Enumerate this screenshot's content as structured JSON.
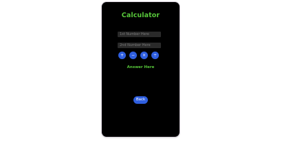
{
  "app": {
    "title": "Calculator"
  },
  "inputs": {
    "first": {
      "value": "",
      "placeholder": "1st Number Here"
    },
    "second": {
      "value": "",
      "placeholder": "2nd Number Here"
    }
  },
  "operators": [
    {
      "label": "+"
    },
    {
      "label": "−"
    },
    {
      "label": "×"
    },
    {
      "label": "÷"
    }
  ],
  "result": {
    "text": "Answer Here"
  },
  "navigation": {
    "back_label": "Back"
  },
  "colors": {
    "accent_green": "#57c73a",
    "button_blue": "#2f5fe0",
    "background": "#000000"
  }
}
